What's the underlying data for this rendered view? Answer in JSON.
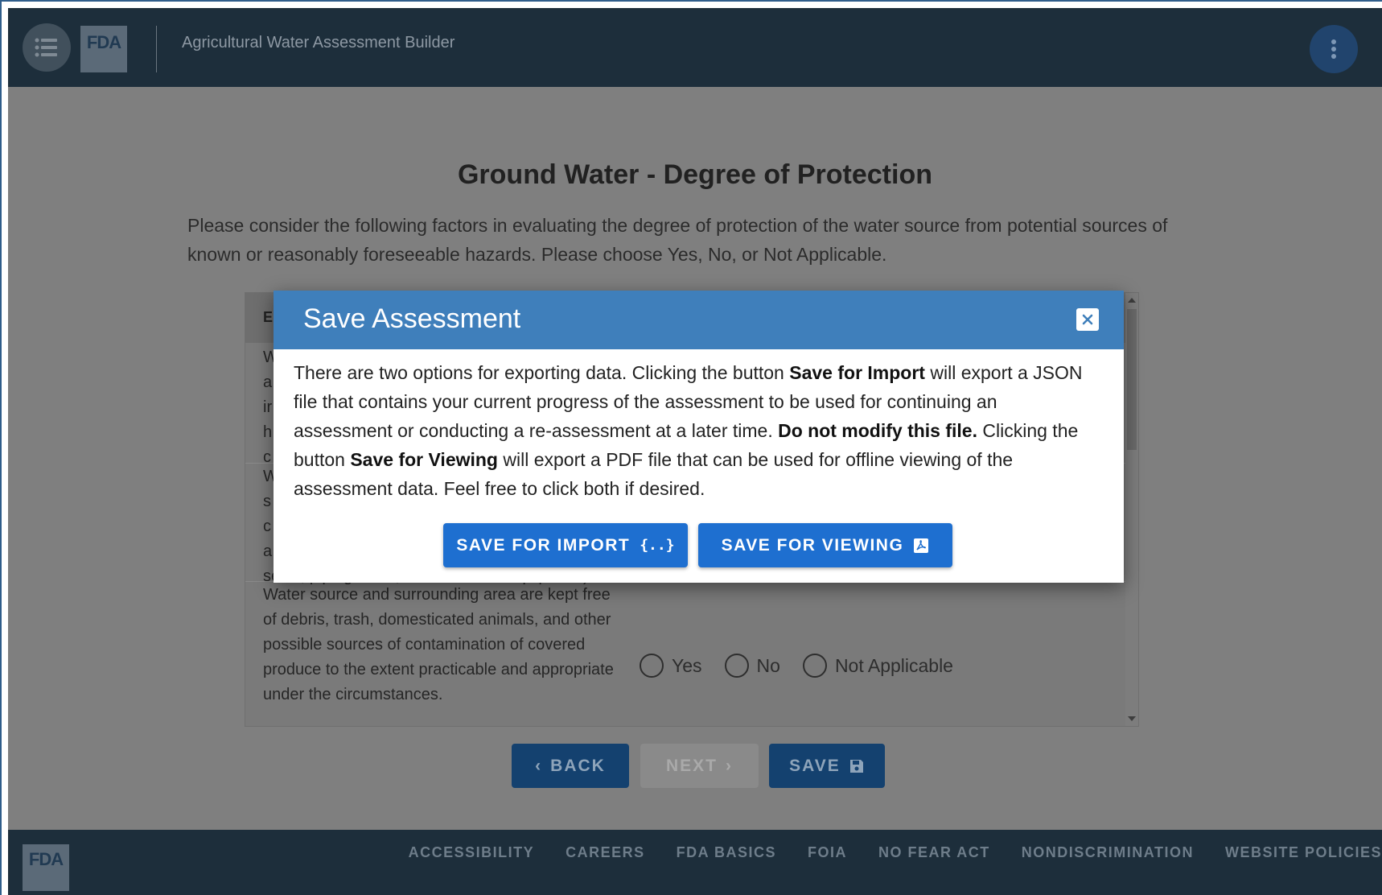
{
  "header": {
    "logo": "FDA",
    "app_title": "Agricultural Water Assessment Builder"
  },
  "page": {
    "title": "Ground Water - Degree of Protection",
    "intro": "Please consider the following factors in evaluating the degree of protection of the water source from potential sources of known or reasonably foreseeable hazards. Please choose Yes, No, or Not Applicable."
  },
  "table": {
    "header_partial": "E",
    "rows": [
      {
        "text": "W\na\nir\nh\nc"
      },
      {
        "text": "W\ns\nc\na\nseals, piping tanks, and treatment equipment)."
      },
      {
        "text": "Water source and surrounding area are kept free of debris, trash, domesticated animals, and other possible sources of contamination of covered produce to the extent practicable and appropriate under the circumstances."
      }
    ],
    "options": [
      "Yes",
      "No",
      "Not Applicable"
    ]
  },
  "nav": {
    "back": "BACK",
    "next": "NEXT",
    "save": "SAVE"
  },
  "footer": {
    "logo": "FDA",
    "links": [
      "ACCESSIBILITY",
      "CAREERS",
      "FDA BASICS",
      "FOIA",
      "NO FEAR ACT",
      "NONDISCRIMINATION",
      "WEBSITE POLICIES"
    ]
  },
  "modal": {
    "title": "Save Assessment",
    "body_1": "There are two options for exporting data. Clicking the button ",
    "body_b1": "Save for Import",
    "body_2": " will export a JSON file that contains your current progress of the assessment to be used for continuing an assessment or conducting a re-assessment at a later time. ",
    "body_b2": "Do not modify this file.",
    "body_3": " Clicking the button ",
    "body_b3": "Save for Viewing",
    "body_4": " will export a PDF file that can be used for offline viewing of the assessment data. Feel free to click both if desired.",
    "import_button": "SAVE FOR IMPORT",
    "import_icon_glyph": "{..}",
    "viewing_button": "SAVE FOR VIEWING"
  },
  "colors": {
    "header_bg": "#1d2e3b",
    "modal_header": "#3f7fbb",
    "primary_button": "#1e6fd0"
  },
  "icons": [
    "menu-list-icon",
    "more-vertical-icon",
    "close-icon",
    "json-braces-icon",
    "pdf-icon",
    "chevron-left-icon",
    "chevron-right-icon",
    "floppy-disk-icon"
  ]
}
